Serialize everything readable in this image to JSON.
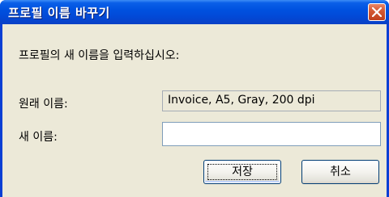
{
  "window": {
    "title": "프로필 이름 바꾸기"
  },
  "dialog": {
    "prompt": "프로필의 새 이름을 입력하십시오:",
    "original_name_label": "원래 이름:",
    "original_name_value": "Invoice, A5, Gray, 200 dpi",
    "new_name_label": "새 이름:",
    "new_name_value": "",
    "new_name_placeholder": ""
  },
  "buttons": {
    "save_label": "저장",
    "cancel_label": "취소"
  },
  "icons": {
    "close": "close-icon"
  },
  "colors": {
    "titlebar": "#0052e0",
    "close_button": "#d55a34",
    "dialog_background": "#ece9d8"
  }
}
